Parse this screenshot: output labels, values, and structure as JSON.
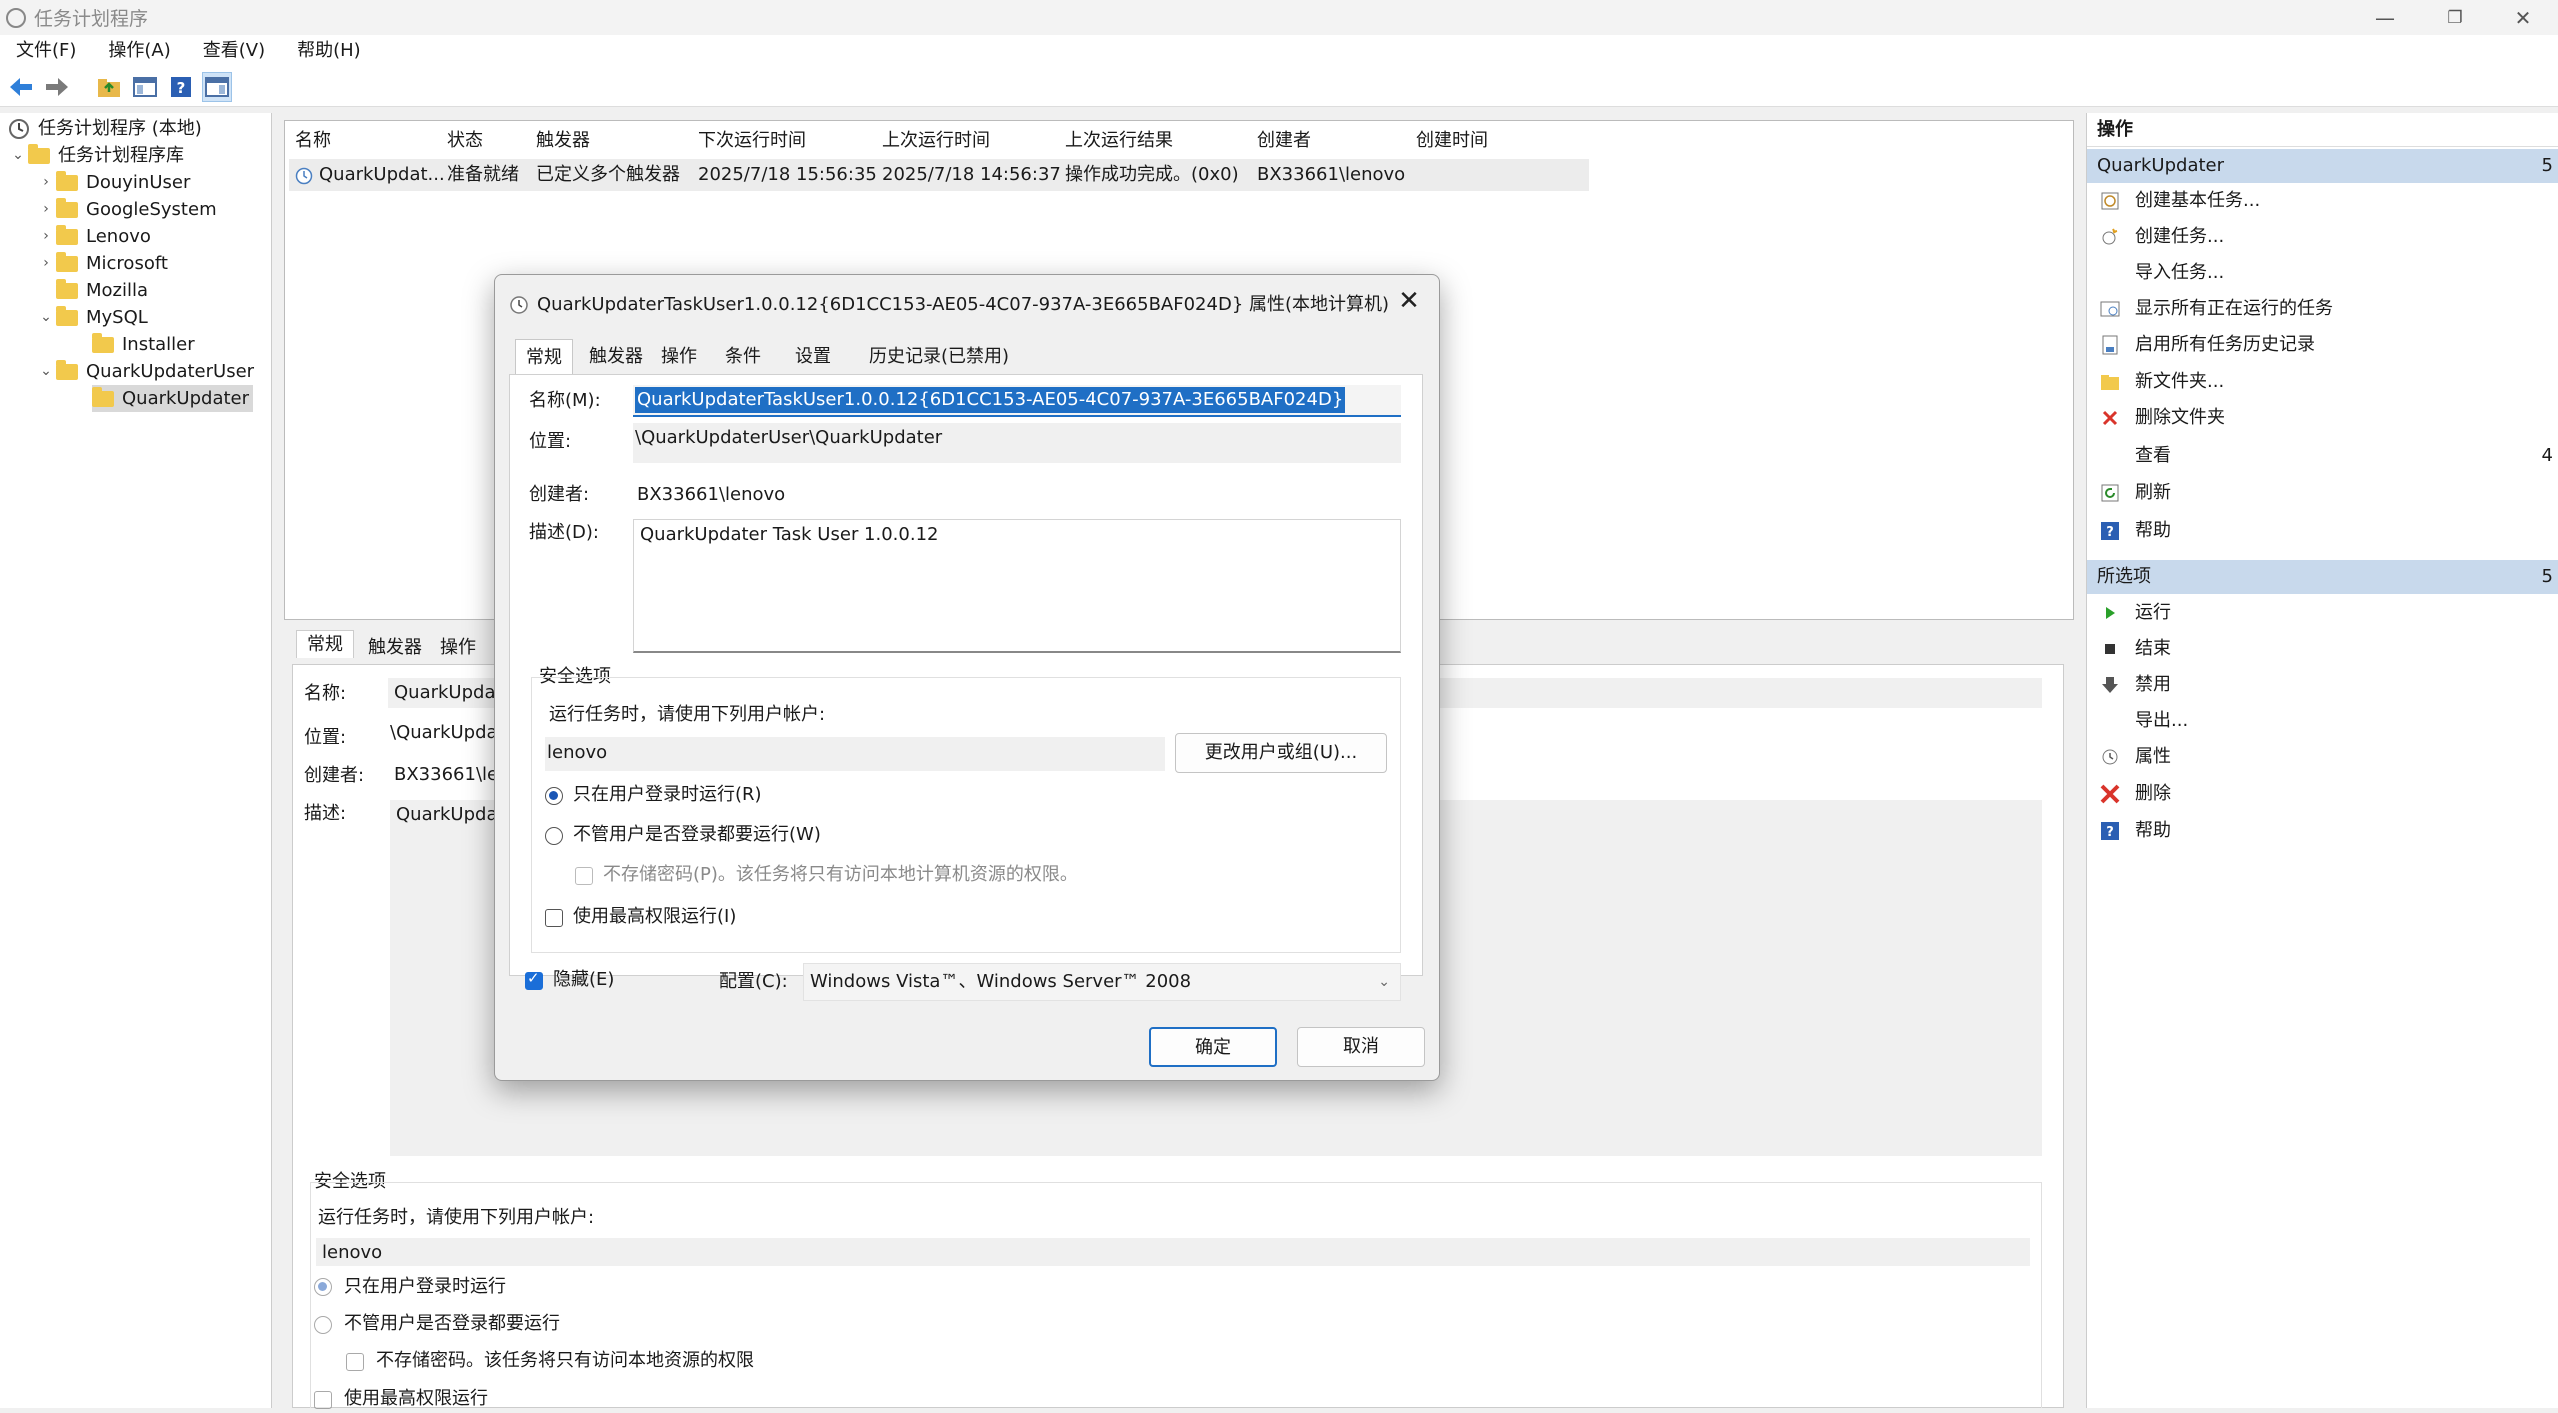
{
  "window": {
    "title": "任务计划程序",
    "minimize": "—",
    "maximize": "❐",
    "close": "✕"
  },
  "menu": [
    "文件(F)",
    "操作(A)",
    "查看(V)",
    "帮助(H)"
  ],
  "tree": {
    "root": "任务计划程序 (本地)",
    "library": "任务计划程序库",
    "folders": [
      "DouyinUser",
      "GoogleSystem",
      "Lenovo",
      "Microsoft",
      "Mozilla",
      "MySQL"
    ],
    "mysql_child": "Installer",
    "quark_parent": "QuarkUpdaterUser",
    "quark_child": "QuarkUpdater"
  },
  "list": {
    "headers": [
      "名称",
      "状态",
      "触发器",
      "下次运行时间",
      "上次运行时间",
      "上次运行结果",
      "创建者",
      "创建时间"
    ],
    "row": [
      "QuarkUpdat...",
      "准备就绪",
      "已定义多个触发器",
      "2025/7/18 15:56:35",
      "2025/7/18 14:56:37",
      "操作成功完成。(0x0)",
      "BX33661\\lenovo",
      ""
    ]
  },
  "detail": {
    "tabs": [
      "常规",
      "触发器",
      "操作"
    ],
    "name_label": "名称:",
    "name_value": "QuarkUpdat",
    "location_label": "位置:",
    "location_value": "\\QuarkUpdat",
    "author_label": "创建者:",
    "author_value": "BX33661\\le",
    "desc_label": "描述:",
    "desc_value": "QuarkUpdat",
    "security_title": "安全选项",
    "run_as_label": "运行任务时，请使用下列用户帐户:",
    "user": "lenovo",
    "radio1": "只在用户登录时运行",
    "radio2": "不管用户是否登录都要运行",
    "no_store": "不存储密码。该任务将只有访问本地资源的权限",
    "highest": "使用最高权限运行"
  },
  "actions": {
    "header": "操作",
    "section1": "QuarkUpdater",
    "section1_count": "5",
    "items1": [
      "创建基本任务...",
      "创建任务...",
      "导入任务...",
      "显示所有正在运行的任务",
      "启用所有任务历史记录",
      "新文件夹...",
      "删除文件夹",
      "查看",
      "刷新",
      "帮助"
    ],
    "view_count": "4",
    "section2": "所选项",
    "section2_count": "5",
    "items2": [
      "运行",
      "结束",
      "禁用",
      "导出...",
      "属性",
      "删除",
      "帮助"
    ]
  },
  "dialog": {
    "title": "QuarkUpdaterTaskUser1.0.0.12{6D1CC153-AE05-4C07-937A-3E665BAF024D} 属性(本地计算机)",
    "tabs": [
      "常规",
      "触发器",
      "操作",
      "条件",
      "设置",
      "历史记录(已禁用)"
    ],
    "name_label": "名称(M):",
    "name_value": "QuarkUpdaterTaskUser1.0.0.12{6D1CC153-AE05-4C07-937A-3E665BAF024D}",
    "location_label": "位置:",
    "location_value": "\\QuarkUpdaterUser\\QuarkUpdater",
    "author_label": "创建者:",
    "author_value": "BX33661\\lenovo",
    "desc_label": "描述(D):",
    "desc_value": "QuarkUpdater Task User 1.0.0.12",
    "security_title": "安全选项",
    "run_as_label": "运行任务时，请使用下列用户帐户:",
    "user": "lenovo",
    "change_user_btn": "更改用户或组(U)...",
    "radio1": "只在用户登录时运行(R)",
    "radio2": "不管用户是否登录都要运行(W)",
    "no_store": "不存储密码(P)。该任务将只有访问本地计算机资源的权限。",
    "highest": "使用最高权限运行(I)",
    "hidden": "隐藏(E)",
    "config_label": "配置(C):",
    "config_value": "Windows Vista™、Windows Server™ 2008",
    "ok": "确定",
    "cancel": "取消"
  }
}
